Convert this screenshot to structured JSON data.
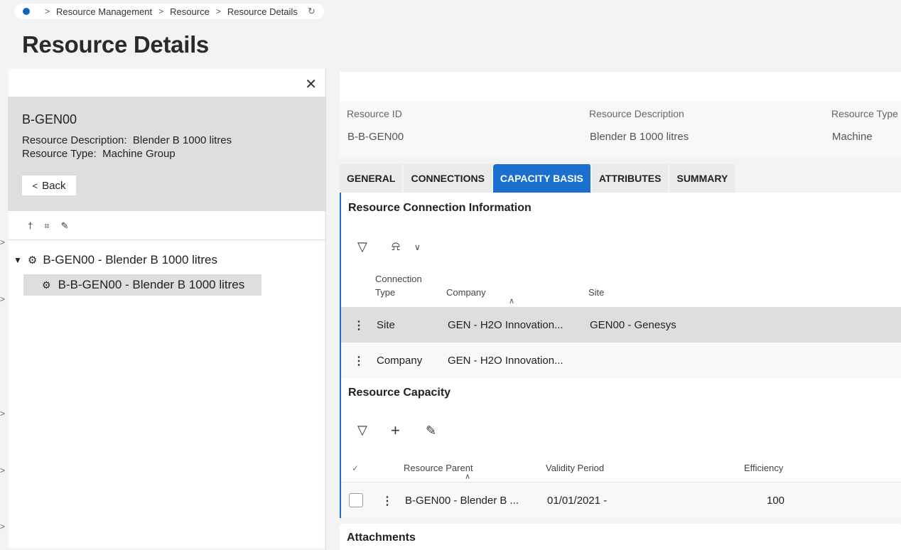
{
  "breadcrumb": {
    "items": [
      "Resource Management",
      "Resource",
      "Resource Details"
    ]
  },
  "page": {
    "title": "Resource Details"
  },
  "left_panel": {
    "resource_id": "B-GEN00",
    "description_label": "Resource Description:",
    "description_value": "Blender B 1000 litres",
    "type_label": "Resource Type:",
    "type_value": "Machine Group",
    "back_label": "Back",
    "tree": {
      "root": "B-GEN00 - Blender B 1000 litres",
      "child": "B-B-GEN00 - Blender B 1000 litres"
    }
  },
  "info": {
    "fields": [
      {
        "label": "Resource ID",
        "value": "B-B-GEN00"
      },
      {
        "label": "Resource Description",
        "value": "Blender B 1000 litres"
      },
      {
        "label": "Resource Type",
        "value": "Machine"
      }
    ]
  },
  "tabs": [
    {
      "label": "GENERAL",
      "active": false
    },
    {
      "label": "CONNECTIONS",
      "active": false
    },
    {
      "label": "CAPACITY BASIS",
      "active": true
    },
    {
      "label": "ATTRIBUTES",
      "active": false
    },
    {
      "label": "SUMMARY",
      "active": false
    }
  ],
  "connections": {
    "title": "Resource Connection Information",
    "headers": {
      "type_line1": "Connection",
      "type_line2": "Type",
      "company": "Company",
      "site": "Site"
    },
    "rows": [
      {
        "type": "Site",
        "company": "GEN - H2O Innovation...",
        "site": "GEN00 - Genesys"
      },
      {
        "type": "Company",
        "company": "GEN - H2O Innovation...",
        "site": ""
      }
    ]
  },
  "capacity": {
    "title": "Resource Capacity",
    "headers": {
      "parent": "Resource Parent",
      "validity": "Validity Period",
      "efficiency": "Efficiency"
    },
    "rows": [
      {
        "parent": "B-GEN00 - Blender B ...",
        "validity": "01/01/2021 -",
        "efficiency": "100"
      }
    ]
  },
  "attachments": {
    "title": "Attachments"
  },
  "colors": {
    "accent": "#1a6fcf",
    "selected_row": "#dedede"
  }
}
